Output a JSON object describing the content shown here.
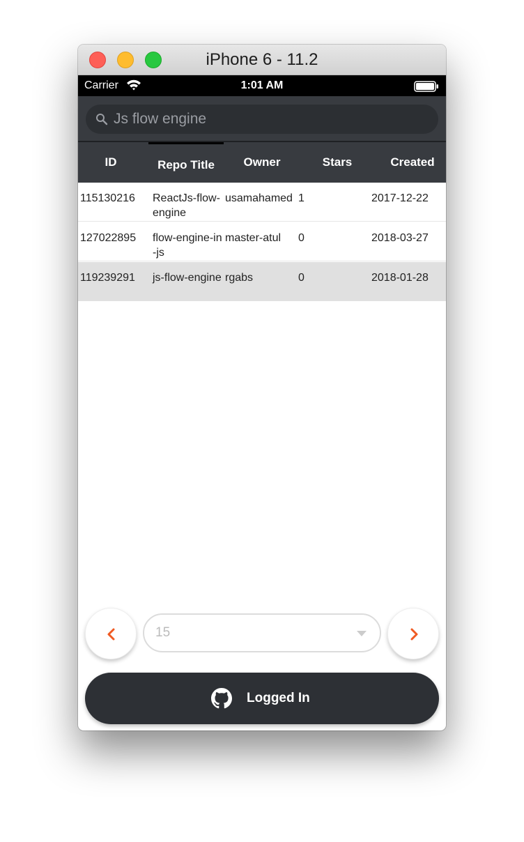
{
  "window": {
    "title": "iPhone 6 - 11.2"
  },
  "status_bar": {
    "carrier": "Carrier",
    "time": "1:01 AM"
  },
  "search": {
    "value": "Js flow engine",
    "icon": "search-icon"
  },
  "table": {
    "columns": [
      "ID",
      "Repo Title",
      "Owner",
      "Stars",
      "Created"
    ],
    "sorted_column": "Repo Title",
    "rows": [
      {
        "id": "115130216",
        "title": "ReactJs-flow-engine",
        "owner": "usamahamed",
        "stars": "1",
        "created": "2017-12-22"
      },
      {
        "id": "127022895",
        "title": "flow-engine-in-js",
        "owner": "master-atul",
        "stars": "0",
        "created": "2018-03-27"
      },
      {
        "id": "119239291",
        "title": "js-flow-engine",
        "owner": "rgabs",
        "stars": "0",
        "created": "2018-01-28"
      }
    ],
    "selected_row": 2
  },
  "pagination": {
    "prev_icon": "chevron-left-icon",
    "next_icon": "chevron-right-icon",
    "per_page": "15"
  },
  "login": {
    "label": "Logged In",
    "icon": "github-icon"
  },
  "colors": {
    "header_bg": "#383b40",
    "accent": "#f05a22",
    "button_dark": "#2d3035",
    "selected_row": "#e0e0e0"
  }
}
